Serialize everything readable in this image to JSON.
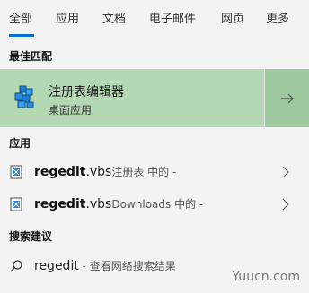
{
  "tabs": [
    {
      "label": "全部",
      "active": true
    },
    {
      "label": "应用"
    },
    {
      "label": "文档"
    },
    {
      "label": "电子邮件"
    },
    {
      "label": "网页"
    },
    {
      "label": "更多"
    }
  ],
  "sections": {
    "best_match": "最佳匹配",
    "apps": "应用",
    "search_suggestions": "搜索建议"
  },
  "best_match": {
    "title": "注册表编辑器",
    "subtitle": "桌面应用"
  },
  "apps": [
    {
      "name_bold": "regedit",
      "name_ext": ".vbs",
      "location": "注册表 中的 -"
    },
    {
      "name_bold": "regedit",
      "name_ext": ".vbs",
      "location": "Downloads 中的 -"
    }
  ],
  "suggestion": {
    "query": "regedit",
    "hint": " - 查看网络搜索结果"
  },
  "watermark": "Yuucn.com",
  "colors": {
    "accent": "#0a6ed1",
    "best_bg": "#b5d8b4",
    "best_arrow_bg": "#9ec89d"
  },
  "icons": [
    "registry-editor-icon",
    "vbs-file-icon",
    "search-icon",
    "arrow-right-icon",
    "chevron-right-icon"
  ]
}
